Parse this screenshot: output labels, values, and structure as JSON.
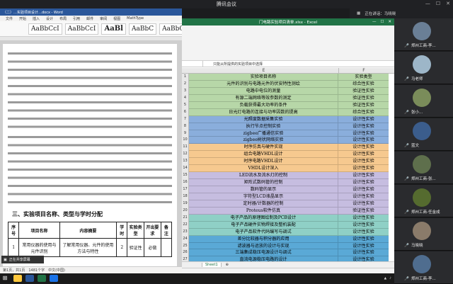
{
  "meeting": {
    "title": "腾讯会议",
    "sharing_label": "正在共享屏幕",
    "speaking_label": "正在讲话：马晓晓"
  },
  "word": {
    "title": "（二）…实验项目设计…docx - Word",
    "tabs": [
      "文件",
      "开始",
      "插入",
      "设计",
      "布局",
      "引用",
      "邮件",
      "审阅",
      "视图",
      "MathType"
    ],
    "styles": [
      "AaBbCcI",
      "AaBbCcI",
      "AaBl",
      "AaBbC",
      "AaBbC"
    ],
    "section_title": "三、实验项目名称、类型与学时分配",
    "table_headers": [
      "序号",
      "项目名称",
      "内容摘要",
      "学时",
      "实验类型",
      "开出要求",
      "备注"
    ],
    "table_row": [
      "1",
      "常用仪器的使用与元件识别",
      "了解常用仪器、元件的使用方法与特性",
      "2",
      "验证性",
      "必做",
      ""
    ],
    "status": "第1页，共1页　1481个字　中文(中国)"
  },
  "excel": {
    "title": "门电路实验项目清单.xlsx - Excel",
    "formula": "只能从所提供的实验项目中选择",
    "col_e": "E",
    "col_f": "F",
    "sheet_tab": "Sheet1",
    "rows": [
      {
        "n": "1",
        "e": "实验项目名称",
        "f": "实验类型",
        "c": "#b7d7a8"
      },
      {
        "n": "2",
        "e": "元件的识别与电路元件的伏安特性测绘",
        "f": "综合性实验",
        "c": "#b7d7a8"
      },
      {
        "n": "3",
        "e": "电路中电位的测量",
        "f": "验证性实验",
        "c": "#b7d7a8"
      },
      {
        "n": "4",
        "e": "有源二端网络等效参数的测定",
        "f": "验证性实验",
        "c": "#b7d7a8"
      },
      {
        "n": "5",
        "e": "负载获得最大功率的条件",
        "f": "验证性实验",
        "c": "#b7d7a8"
      },
      {
        "n": "6",
        "e": "日光灯电路的连接与功率因数的提高",
        "f": "综合性实验",
        "c": "#b7d7a8"
      },
      {
        "n": "7",
        "e": "光照度数据采集实验",
        "f": "设计性实验",
        "c": "#8aaedc"
      },
      {
        "n": "8",
        "e": "执行节点控制实验",
        "f": "设计性实验",
        "c": "#8aaedc"
      },
      {
        "n": "9",
        "e": "zigbee广播通信实验",
        "f": "设计性实验",
        "c": "#8aaedc"
      },
      {
        "n": "10",
        "e": "zigbee树状网络实验",
        "f": "设计性实验",
        "c": "#8aaedc"
      },
      {
        "n": "11",
        "e": "时序仿真与硬件实现",
        "f": "设计性实验",
        "c": "#f6c98f"
      },
      {
        "n": "12",
        "e": "组合电路VHDL设计",
        "f": "设计性实验",
        "c": "#f6c98f"
      },
      {
        "n": "13",
        "e": "时序电路VHDL设计",
        "f": "设计性实验",
        "c": "#f6c98f"
      },
      {
        "n": "14",
        "e": "VHDL设计深入",
        "f": "设计性实验",
        "c": "#f6c98f"
      },
      {
        "n": "15",
        "e": "LED流水及流水灯的控制",
        "f": "设计性实验",
        "c": "#c6bde0"
      },
      {
        "n": "16",
        "e": "矩阵式数码管的控制",
        "f": "设计性实验",
        "c": "#c6bde0"
      },
      {
        "n": "17",
        "e": "数码管的显示",
        "f": "设计性实验",
        "c": "#c6bde0"
      },
      {
        "n": "18",
        "e": "字符型LCD液晶显示",
        "f": "设计性实验",
        "c": "#c6bde0"
      },
      {
        "n": "19",
        "e": "定时器/计数器的控制",
        "f": "设计性实验",
        "c": "#c6bde0"
      },
      {
        "n": "20",
        "e": "Proteus软件仿真",
        "f": "验证性实验",
        "c": "#c6bde0"
      },
      {
        "n": "21",
        "e": "电子产品的原理图绘制及PCB设计",
        "f": "设计性实验",
        "c": "#8fd0c6"
      },
      {
        "n": "22",
        "e": "电子产品硬件实物焊接及整机装配",
        "f": "设计性实验",
        "c": "#8fd0c6"
      },
      {
        "n": "23",
        "e": "电子产品软件代码编写与调试",
        "f": "设计性实验",
        "c": "#8fd0c6"
      },
      {
        "n": "24",
        "e": "差分比较器与积分器的应用",
        "f": "设计性实验",
        "c": "#5aa9d6"
      },
      {
        "n": "25",
        "e": "滤波器与运放的设计与实现",
        "f": "设计性实验",
        "c": "#5aa9d6"
      },
      {
        "n": "26",
        "e": "三端集成稳压电源设计与调试",
        "f": "设计性实验",
        "c": "#5aa9d6"
      },
      {
        "n": "27",
        "e": "直流电源稳压电路的设计",
        "f": "设计性实验",
        "c": "#5aa9d6"
      }
    ]
  },
  "participants": [
    {
      "name": "郑州工商-李...",
      "color": "#6a7f96"
    },
    {
      "name": "马老师",
      "color": "#9db6c8"
    },
    {
      "name": "张小...",
      "color": "#7a8c5a"
    },
    {
      "name": "蓝文",
      "color": "#3b5d8c"
    },
    {
      "name": "郑州工商-张...",
      "color": "#5e6f4c"
    },
    {
      "name": "郑州工商-任金成",
      "color": "#556b2f"
    },
    {
      "name": "马晓晓",
      "color": "#8a7b6a"
    },
    {
      "name": "郑州工商-李...",
      "color": "#4f6d8f"
    }
  ]
}
